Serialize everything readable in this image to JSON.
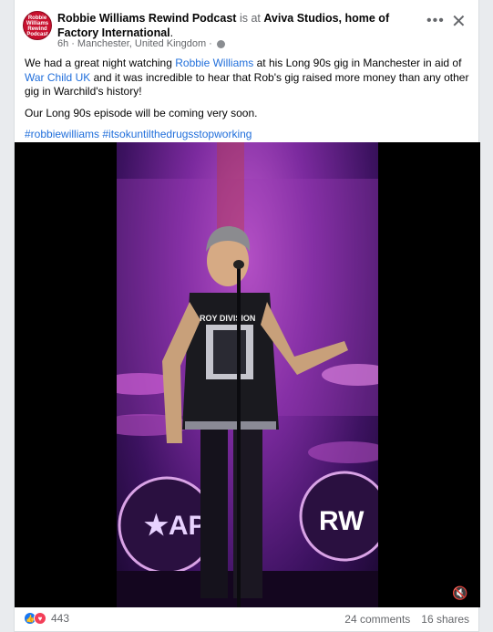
{
  "post": {
    "page_name": "Robbie Williams Rewind Podcast",
    "is_at": "is at",
    "place_name": "Aviva Studios, home of Factory International",
    "period": ".",
    "time": "6h",
    "separator": "·",
    "location": "Manchester, United Kingdom",
    "avatar_lines": [
      "Robbie",
      "Williams",
      "Rewind",
      "Podcast"
    ],
    "text": {
      "p1_part1": "We had a great night watching",
      "p1_link1": "Robbie Williams",
      "p1_part2": "at his Long 90s gig in Manchester in aid of",
      "p1_link2": "War Child UK",
      "p1_part3": "and it was incredible to hear that Rob's gig raised more money than any other gig in Warchild's history!",
      "p2": "Our Long 90s episode will be coming very soon.",
      "hashtags": "#robbiewilliams #itsokuntilthedrugsstopworking"
    }
  },
  "video": {
    "shirt_text": "ROY DIVISION",
    "drum_logo": "RW"
  },
  "footer": {
    "reaction_count": "443",
    "comments": "24 comments",
    "shares": "16 shares"
  },
  "icons": {
    "more": "more-options-icon",
    "close": "close-icon",
    "privacy": "globe-icon",
    "sound": "speaker-muted-icon"
  }
}
